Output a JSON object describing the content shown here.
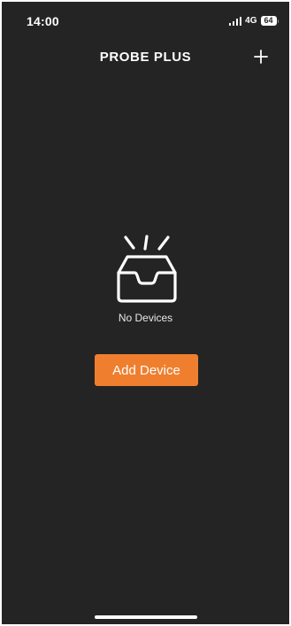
{
  "status_bar": {
    "time": "14:00",
    "network": "4G",
    "battery": "64",
    "signal_bars": 4,
    "wifi_icon": "cellular-signal-icon"
  },
  "nav": {
    "title": "PROBE PLUS",
    "add_icon": "plus-icon"
  },
  "empty_state": {
    "icon": "empty-inbox-icon",
    "label": "No Devices"
  },
  "actions": {
    "add_device_label": "Add Device"
  },
  "colors": {
    "background": "#242424",
    "accent": "#ef7f2f",
    "text": "#ffffff"
  }
}
